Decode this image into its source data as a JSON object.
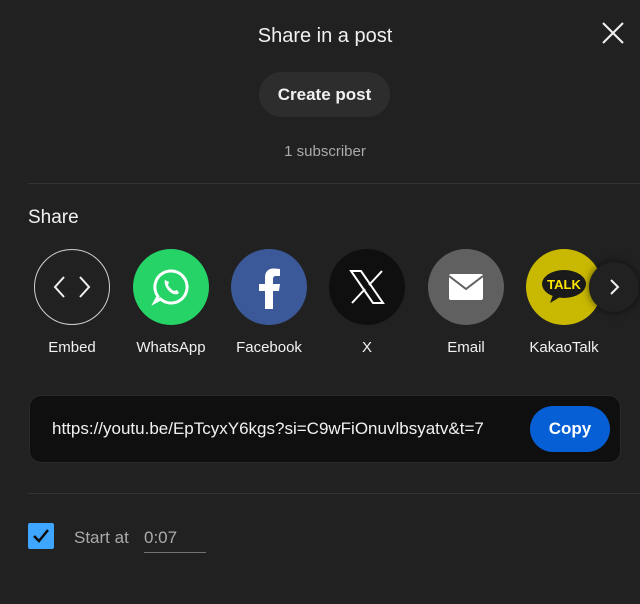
{
  "dialog": {
    "title": "Share in a post",
    "create_post_label": "Create post",
    "subscriber_count": "1 subscriber"
  },
  "share": {
    "heading": "Share",
    "targets": [
      {
        "label": "Embed",
        "icon": "embed-code-icon",
        "color": "#212121"
      },
      {
        "label": "WhatsApp",
        "icon": "whatsapp-icon",
        "color": "#25d366"
      },
      {
        "label": "Facebook",
        "icon": "facebook-icon",
        "color": "#3b5998"
      },
      {
        "label": "X",
        "icon": "x-logo-icon",
        "color": "#0f0f0f"
      },
      {
        "label": "Email",
        "icon": "email-icon",
        "color": "#606060"
      },
      {
        "label": "KakaoTalk",
        "icon": "kakaotalk-icon",
        "color": "#fee500",
        "badge_text": "TALK"
      }
    ]
  },
  "link": {
    "url": "https://youtu.be/EpTcyxY6kgs?si=C9wFiOnuvlbsyatv&t=7",
    "copy_label": "Copy"
  },
  "start_at": {
    "label": "Start at",
    "value": "0:07",
    "checked": true
  },
  "colors": {
    "background": "#212121",
    "accent_blue": "#065fd4",
    "checkbox_blue": "#3ea6ff"
  }
}
